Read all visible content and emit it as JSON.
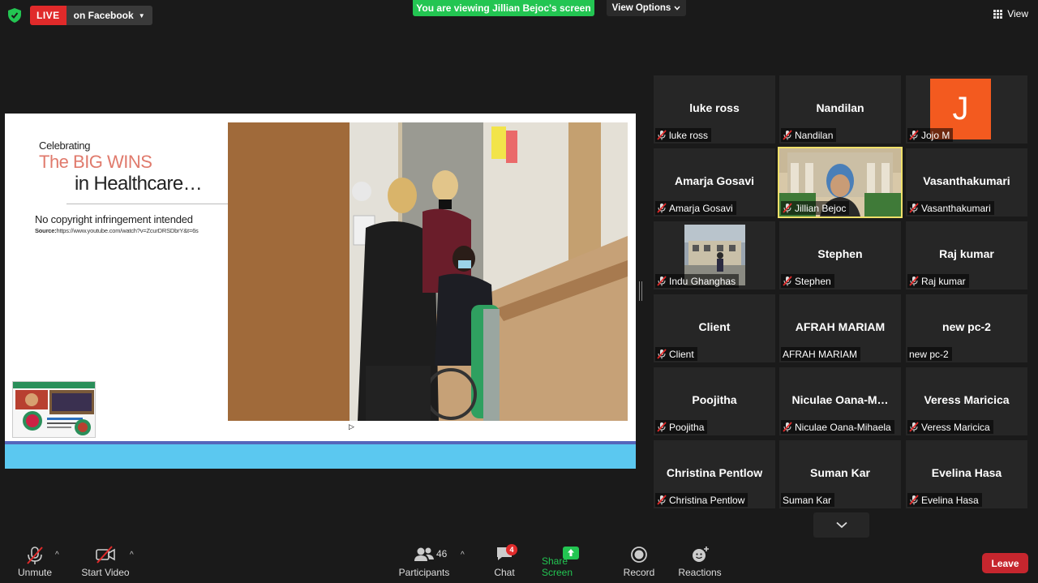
{
  "top": {
    "live_label": "LIVE",
    "live_target": "on Facebook",
    "banner": "You are viewing Jillian Bejoc's screen",
    "view_options": "View Options",
    "view": "View"
  },
  "slide": {
    "celebrating": "Celebrating",
    "big_wins": "The BIG WINS",
    "in_healthcare": "in Healthcare…",
    "copyright": "No copyright infringement intended",
    "source_label": "Source:",
    "source_url": "https://www.youtube.com/watch?v=ZcurDRSDbrY&t=6s"
  },
  "participants_tiles": [
    {
      "name": "luke ross",
      "label": "luke ross",
      "muted": true
    },
    {
      "name": "Nandilan",
      "label": "Nandilan",
      "muted": true
    },
    {
      "name": "",
      "label": "Jojo M",
      "muted": true,
      "avatar": "J"
    },
    {
      "name": "Amarja Gosavi",
      "label": "Amarja Gosavi",
      "muted": true
    },
    {
      "name": "",
      "label": "Jillian Bejoc",
      "muted": true,
      "video": true
    },
    {
      "name": "Vasanthakumari",
      "label": "Vasanthakumari",
      "muted": true
    },
    {
      "name": "",
      "label": "Indu Ghanghas",
      "muted": true,
      "video": true
    },
    {
      "name": "Stephen",
      "label": "Stephen",
      "muted": true
    },
    {
      "name": "Raj kumar",
      "label": "Raj kumar",
      "muted": true
    },
    {
      "name": "Client",
      "label": "Client",
      "muted": true
    },
    {
      "name": "AFRAH MARIAM",
      "label": "AFRAH MARIAM",
      "muted": false
    },
    {
      "name": "new pc-2",
      "label": "new pc-2",
      "muted": false
    },
    {
      "name": "Poojitha",
      "label": "Poojitha",
      "muted": true
    },
    {
      "name": "Niculae  Oana-M…",
      "label": "Niculae Oana-Mihaela",
      "muted": true
    },
    {
      "name": "Veress Maricica",
      "label": "Veress Maricica",
      "muted": true
    },
    {
      "name": "Christina Pentlow",
      "label": "Christina Pentlow",
      "muted": true
    },
    {
      "name": "Suman Kar",
      "label": "Suman Kar",
      "muted": false
    },
    {
      "name": "Evelina Hasa",
      "label": "Evelina Hasa",
      "muted": true
    }
  ],
  "toolbar": {
    "unmute": "Unmute",
    "start_video": "Start Video",
    "participants": "Participants",
    "participants_count": "46",
    "chat": "Chat",
    "chat_badge": "4",
    "share_screen": "Share Screen",
    "record": "Record",
    "reactions": "Reactions",
    "leave": "Leave"
  },
  "colors": {
    "live": "#e02a2a",
    "banner": "#23c552",
    "share": "#23c552",
    "leave": "#c6262e",
    "active_speaker": "#f0e06a",
    "avatar_j": "#f35a1f"
  }
}
